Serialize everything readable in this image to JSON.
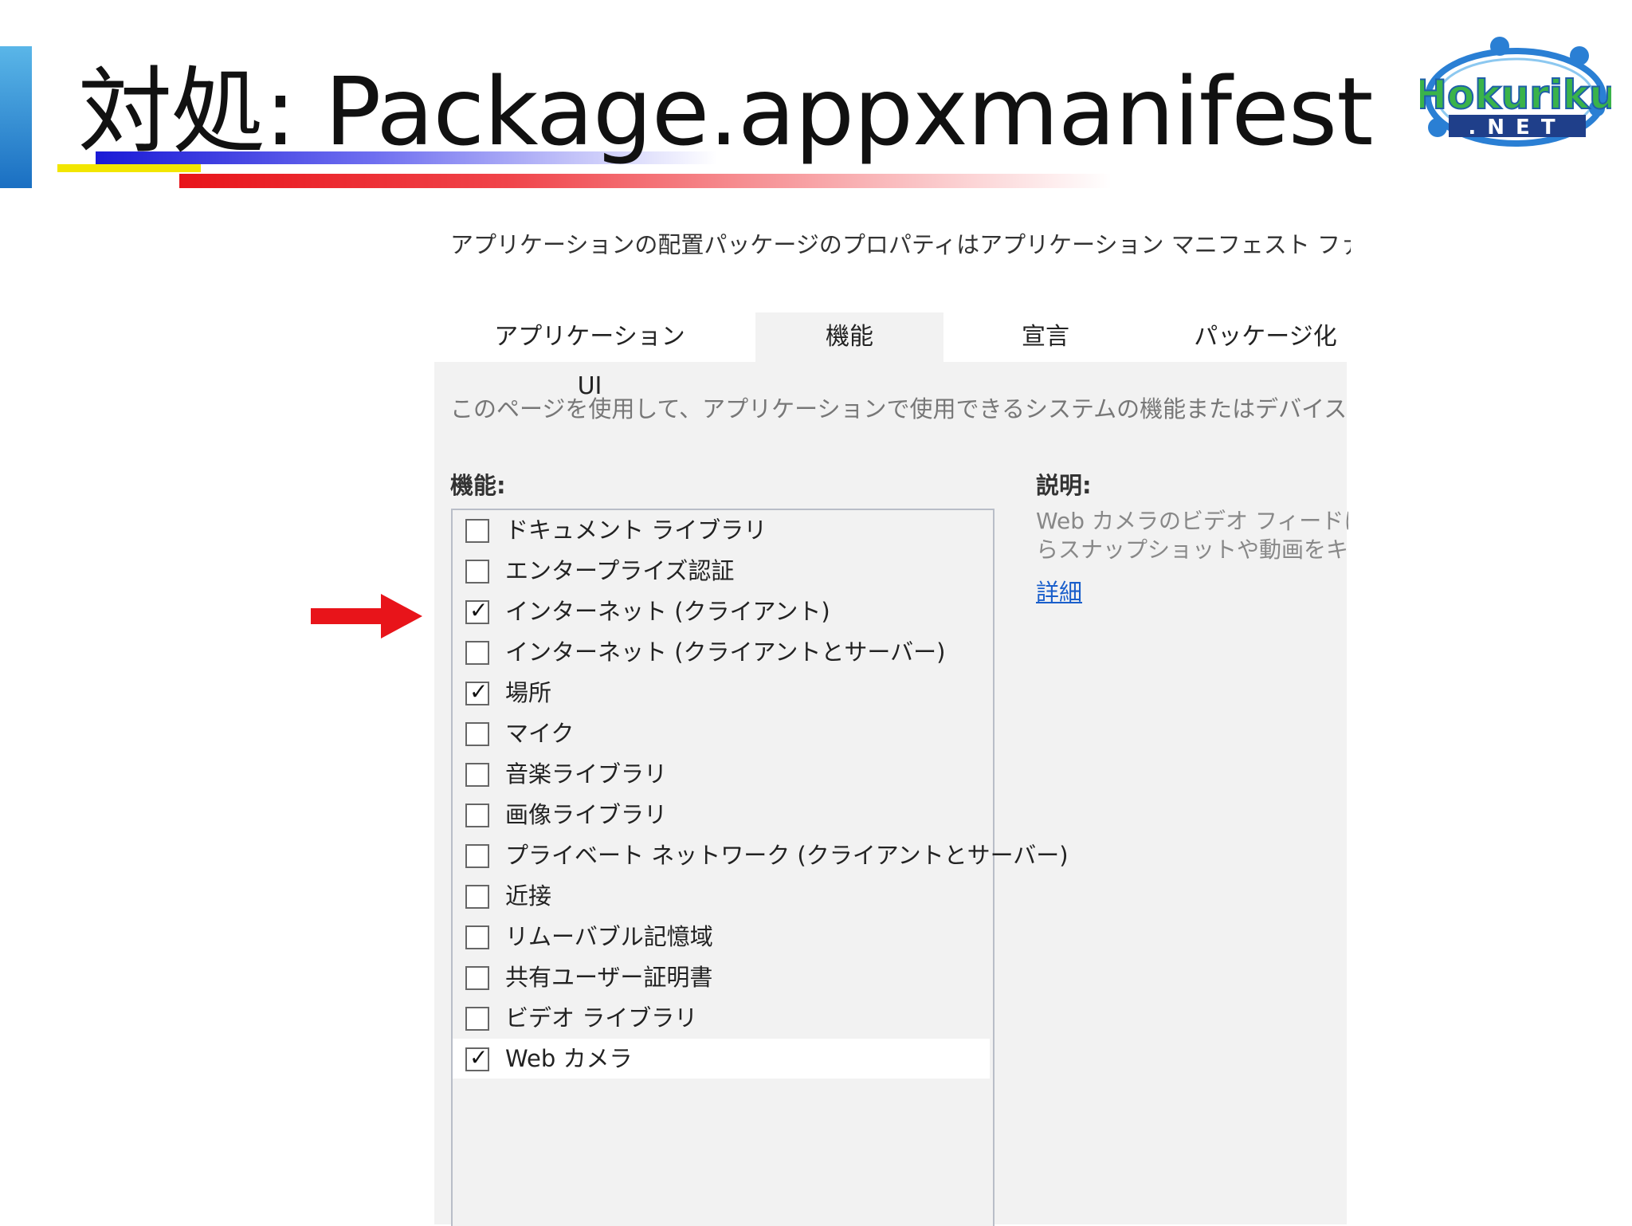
{
  "slide": {
    "title": "対処: Package.appxmanifest",
    "logo_text_top": "Hokuriku",
    "logo_text_bottom": ".NET",
    "colors": {
      "accent": "#1a6fc2",
      "underline_blue": "#1a1ad6",
      "underline_red": "#e8141a",
      "underline_yellow": "#f2e600",
      "arrow": "#e8141a"
    }
  },
  "editor": {
    "intro": "アプリケーションの配置パッケージのプロパティはアプリケーション マニフェスト ファイルに格納され",
    "tabs": [
      {
        "label": "アプリケーション UI",
        "active": false
      },
      {
        "label": "機能",
        "active": true
      },
      {
        "label": "宣言",
        "active": false
      },
      {
        "label": "パッケージ化",
        "active": false
      }
    ],
    "page_description": "このページを使用して、アプリケーションで使用できるシステムの機能またはデバイスを指定し",
    "capabilities_heading": "機能:",
    "description_heading": "説明:",
    "capabilities": [
      {
        "label": "ドキュメント ライブラリ",
        "checked": false
      },
      {
        "label": "エンタープライズ認証",
        "checked": false
      },
      {
        "label": "インターネット (クライアント)",
        "checked": true
      },
      {
        "label": "インターネット (クライアントとサーバー)",
        "checked": false
      },
      {
        "label": "場所",
        "checked": true
      },
      {
        "label": "マイク",
        "checked": false
      },
      {
        "label": "音楽ライブラリ",
        "checked": false
      },
      {
        "label": "画像ライブラリ",
        "checked": false
      },
      {
        "label": "プライベート ネットワーク (クライアントとサーバー)",
        "checked": false
      },
      {
        "label": "近接",
        "checked": false
      },
      {
        "label": "リムーバブル記憶域",
        "checked": false
      },
      {
        "label": "共有ユーザー証明書",
        "checked": false
      },
      {
        "label": "ビデオ ライブラリ",
        "checked": false
      },
      {
        "label": "Web カメラ",
        "checked": true,
        "selected": true
      }
    ],
    "description_line1": "Web カメラのビデオ フィードにア",
    "description_line2": "らスナップショットや動画をキャプ",
    "details_link": "詳細",
    "checkmark": "✓"
  }
}
